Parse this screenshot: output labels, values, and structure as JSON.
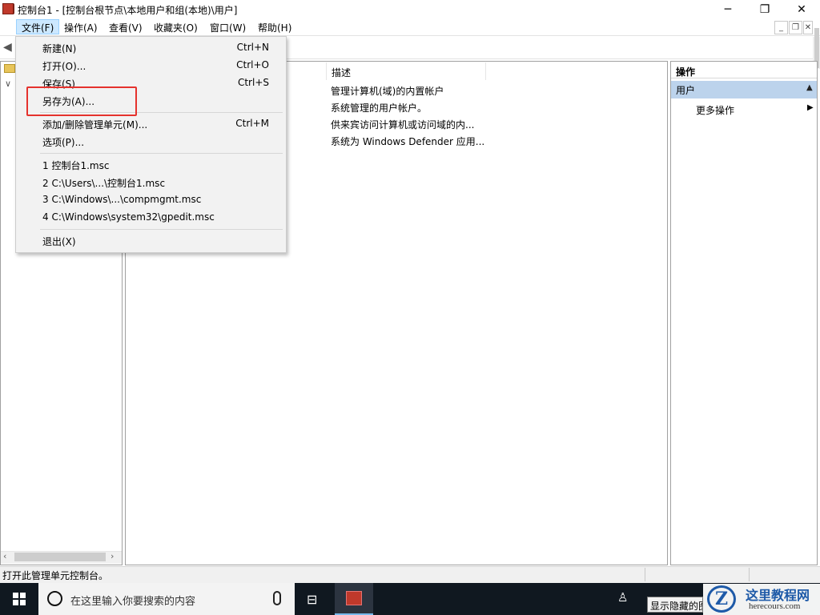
{
  "window": {
    "title": "控制台1 - [控制台根节点\\本地用户和组(本地)\\用户]",
    "minimize": "─",
    "restore": "❐",
    "close": "✕"
  },
  "menubar": {
    "items": [
      "文件(F)",
      "操作(A)",
      "查看(V)",
      "收藏夹(O)",
      "窗口(W)",
      "帮助(H)"
    ],
    "active_index": 0
  },
  "mdi_buttons": [
    "_",
    "❐",
    "✕"
  ],
  "file_menu": {
    "groups": [
      [
        {
          "label": "新建(N)",
          "shortcut": "Ctrl+N"
        },
        {
          "label": "打开(O)...",
          "shortcut": "Ctrl+O"
        },
        {
          "label": "保存(S)",
          "shortcut": "Ctrl+S"
        },
        {
          "label": "另存为(A)...",
          "shortcut": "",
          "highlighted": true
        }
      ],
      [
        {
          "label": "添加/删除管理单元(M)...",
          "shortcut": "Ctrl+M"
        },
        {
          "label": "选项(P)...",
          "shortcut": ""
        }
      ],
      [
        {
          "label": "1 控制台1.msc"
        },
        {
          "label": "2 C:\\Users\\...\\控制台1.msc"
        },
        {
          "label": "3 C:\\Windows\\...\\compmgmt.msc"
        },
        {
          "label": "4 C:\\Windows\\system32\\gpedit.msc"
        }
      ],
      [
        {
          "label": "退出(X)"
        }
      ]
    ]
  },
  "list": {
    "column_description": "描述",
    "rows": [
      "管理计算机(域)的内置帐户",
      "系统管理的用户帐户。",
      "供来宾访问计算机或访问域的内...",
      "系统为 Windows Defender 应用..."
    ]
  },
  "actions": {
    "header": "操作",
    "section": "用户",
    "more": "更多操作"
  },
  "statusbar": {
    "text": "打开此管理单元控制台。"
  },
  "taskbar": {
    "search_placeholder": "在这里输入你要搜索的内容",
    "tooltip": "显示隐藏的图标"
  },
  "watermark": {
    "logo_letter": "Z",
    "cn": "这里教程网",
    "en": "herecours.com"
  },
  "colors": {
    "menu_highlight": "#cce8ff",
    "annotation_red": "#e5322d",
    "actions_section": "#bcd3ec",
    "taskbar": "#101820"
  }
}
